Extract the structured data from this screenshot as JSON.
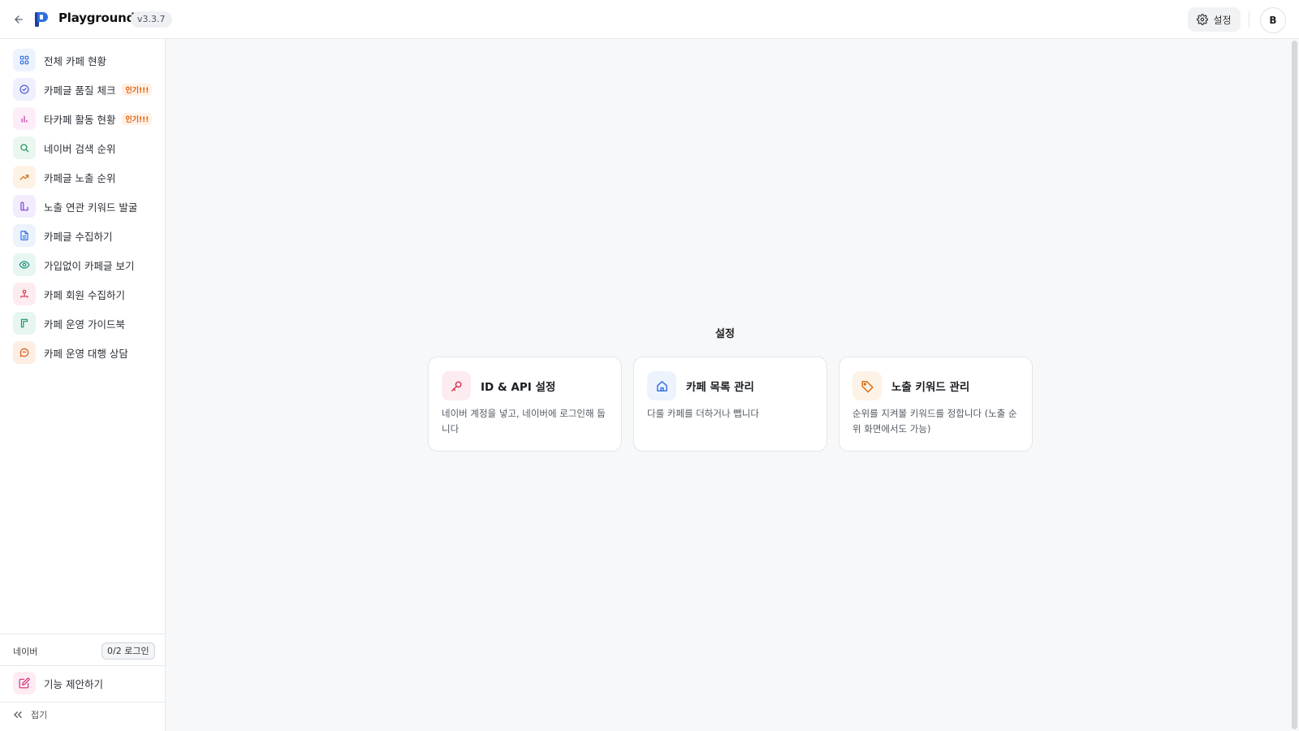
{
  "header": {
    "app_title": "Playground",
    "version": "v3.3.7",
    "settings_label": "설정",
    "avatar_initial": "B"
  },
  "sidebar": {
    "items": [
      {
        "label": "전체 카페 현황",
        "icon": "grid-icon",
        "color": "#2f6fe0",
        "bg": "#edf3fd"
      },
      {
        "label": "카페글 품질 체크",
        "icon": "check-circle-icon",
        "color": "#4b4ed6",
        "bg": "#eef0fd",
        "badge": "인기!!!"
      },
      {
        "label": "타카페 활동 현황",
        "icon": "bar-chart-icon",
        "color": "#c02ea8",
        "bg": "#fcedf8",
        "badge": "인기!!!"
      },
      {
        "label": "네이버 검색 순위",
        "icon": "search-icon",
        "color": "#14905a",
        "bg": "#e9f7ef"
      },
      {
        "label": "카페글 노출 순위",
        "icon": "trending-up-icon",
        "color": "#d36a10",
        "bg": "#fdf2e6"
      },
      {
        "label": "노출 연관 키워드 발굴",
        "icon": "layout-icon",
        "color": "#7a3fd8",
        "bg": "#f3ecfd"
      },
      {
        "label": "카페글 수집하기",
        "icon": "document-icon",
        "color": "#2f6fe0",
        "bg": "#edf3fd"
      },
      {
        "label": "가입없이 카페글 보기",
        "icon": "eye-icon",
        "color": "#178f74",
        "bg": "#e7f6f1"
      },
      {
        "label": "카페 회원 수집하기",
        "icon": "network-icon",
        "color": "#d3304f",
        "bg": "#fdecef"
      },
      {
        "label": "카페 운영 가이드북",
        "icon": "book-icon",
        "color": "#178f74",
        "bg": "#e7f6f1"
      },
      {
        "label": "카페 운영 대행 상담",
        "icon": "chat-icon",
        "color": "#d85a12",
        "bg": "#fdeee4"
      }
    ],
    "naver_label": "네이버",
    "login_status": "0/2 로그인",
    "suggest_label": "기능 제안하기",
    "collapse_label": "접기"
  },
  "main": {
    "section_title": "설정",
    "cards": [
      {
        "title": "ID & API 설정",
        "desc": "네이버 계정을 넣고, 네이버에 로그인해 둡니다",
        "icon": "key-icon",
        "color": "#d3304f",
        "bg": "#fdecef"
      },
      {
        "title": "카페 목록 관리",
        "desc": "다룰 카페를 더하거나 뺍니다",
        "icon": "home-icon",
        "color": "#2f6fe0",
        "bg": "#edf3fd"
      },
      {
        "title": "노출 키워드 관리",
        "desc": "순위를 지켜볼 키워드를 정합니다 (노출 순위 화면에서도 가능)",
        "icon": "tag-icon",
        "color": "#d36a10",
        "bg": "#fdf2e6"
      }
    ]
  }
}
